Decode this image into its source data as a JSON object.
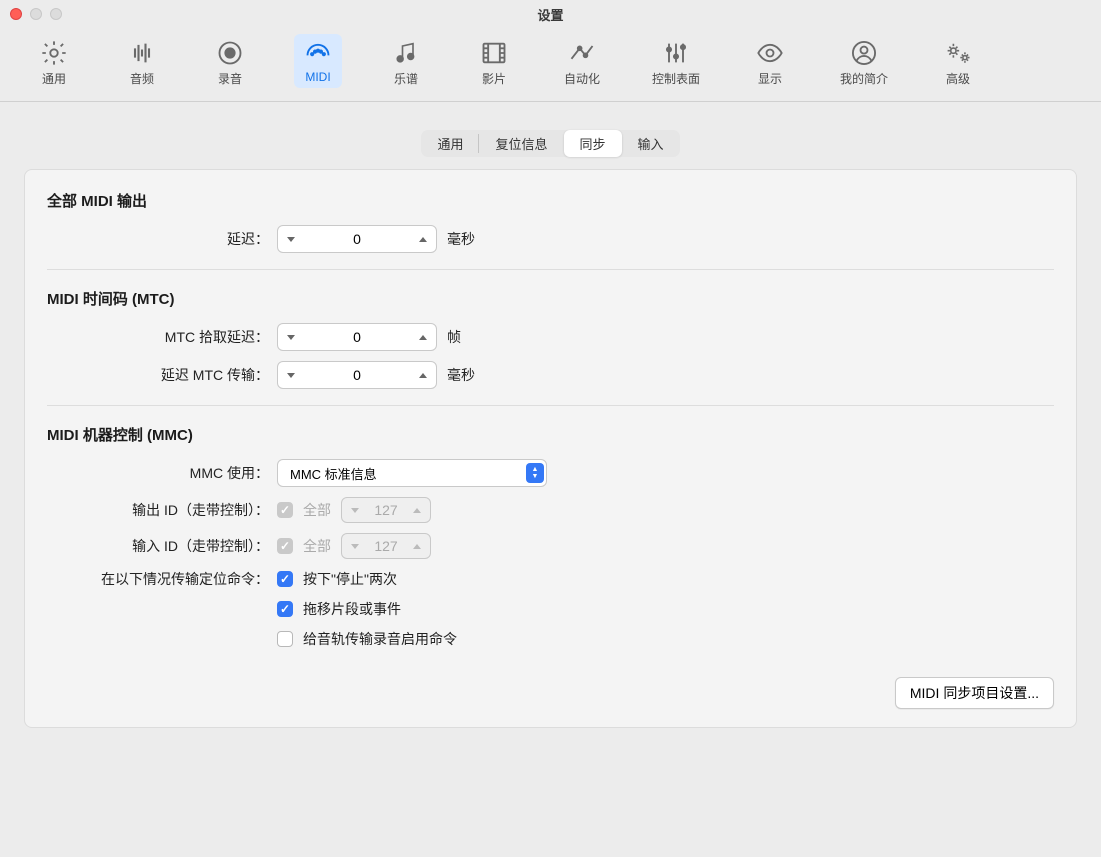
{
  "window_title": "设置",
  "toolbar": [
    {
      "id": "general",
      "label": "通用"
    },
    {
      "id": "audio",
      "label": "音频"
    },
    {
      "id": "recording",
      "label": "录音"
    },
    {
      "id": "midi",
      "label": "MIDI"
    },
    {
      "id": "score",
      "label": "乐谱"
    },
    {
      "id": "movie",
      "label": "影片"
    },
    {
      "id": "automation",
      "label": "自动化"
    },
    {
      "id": "control-surfaces",
      "label": "控制表面"
    },
    {
      "id": "display",
      "label": "显示"
    },
    {
      "id": "my-info",
      "label": "我的简介"
    },
    {
      "id": "advanced",
      "label": "高级"
    }
  ],
  "selected_toolbar": "midi",
  "subtabs": {
    "general": "通用",
    "reset": "复位信息",
    "sync": "同步",
    "input": "输入",
    "active": "sync"
  },
  "sections": {
    "all_midi_output": {
      "title": "全部 MIDI 输出",
      "delay_label": "延迟：",
      "delay_value": "0",
      "delay_unit": "毫秒"
    },
    "mtc": {
      "title": "MIDI 时间码 (MTC)",
      "pickup_label": "MTC 拾取延迟：",
      "pickup_value": "0",
      "pickup_unit": "帧",
      "delay_label": "延迟 MTC 传输：",
      "delay_value": "0",
      "delay_unit": "毫秒"
    },
    "mmc": {
      "title": "MIDI 机器控制 (MMC)",
      "uses_label": "MMC 使用：",
      "uses_value": "MMC 标准信息",
      "out_id_label": "输出 ID（走带控制）：",
      "out_id_all": "全部",
      "out_id_val": "127",
      "in_id_label": "输入 ID（走带控制）：",
      "in_id_all": "全部",
      "in_id_val": "127",
      "transmit_label": "在以下情况传输定位命令：",
      "opt_stop_twice": "按下\"停止\"两次",
      "opt_drag": "拖移片段或事件",
      "opt_enable_record": "给音轨传输录音启用命令"
    }
  },
  "footer_button": "MIDI 同步项目设置..."
}
